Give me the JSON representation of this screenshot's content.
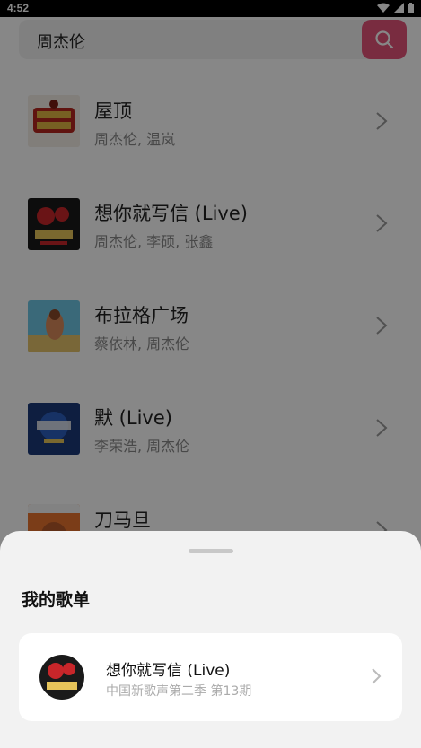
{
  "status_bar": {
    "time": "4:52"
  },
  "search": {
    "query": "周杰伦"
  },
  "songs": [
    {
      "title": "屋顶",
      "artist": "周杰伦, 温岚"
    },
    {
      "title": "想你就写信 (Live)",
      "artist": "周杰伦, 李硕, 张鑫"
    },
    {
      "title": "布拉格广场",
      "artist": "蔡依林, 周杰伦"
    },
    {
      "title": "默 (Live)",
      "artist": "李荣浩, 周杰伦"
    },
    {
      "title": "刀马旦",
      "artist": ""
    }
  ],
  "sheet": {
    "title": "我的歌单",
    "playlist": {
      "title": "想你就写信 (Live)",
      "subtitle": "中国新歌声第二季 第13期"
    }
  },
  "colors": {
    "accent": "#e5537a",
    "overlay": "rgba(0,0,0,0.47)"
  }
}
